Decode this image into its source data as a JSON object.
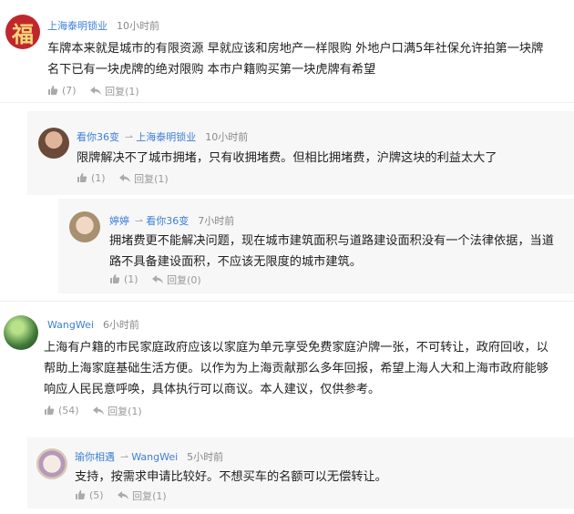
{
  "comments": [
    {
      "user": "上海泰明锁业",
      "time": "10小时前",
      "text_lines": [
        "车牌本来就是城市的有限资源 早就应该和房地产一样限购 外地户口满5年社保允许拍第一块牌",
        "名下已有一块虎牌的绝对限购 本市户籍购买第一块虎牌有希望"
      ],
      "like": "(7)",
      "reply_label": "回复",
      "reply_count": "(1)",
      "avatar_char": "福",
      "avatar_color": "#c0272d"
    },
    {
      "user": "看你36变",
      "reply_to": "上海泰明锁业",
      "time": "10小时前",
      "text_lines": [
        "限牌解决不了城市拥堵，只有收拥堵费。但相比拥堵费，沪牌这块的利益太大了"
      ],
      "like": "(1)",
      "reply_label": "回复",
      "reply_count": "(1)",
      "avatar_color": "#6b4a3a"
    },
    {
      "user": "婷婷",
      "reply_to": "看你36变",
      "time": "7小时前",
      "text_lines": [
        "拥堵费更不能解决问题，现在城市建筑面积与道路建设面积没有一个法律依据，当道",
        "路不具备建设面积，不应该无限度的城市建筑。"
      ],
      "like": "(1)",
      "reply_label": "回复",
      "reply_count": "(0)",
      "avatar_color": "#a89070"
    },
    {
      "user": "WangWei",
      "time": "6小时前",
      "text_lines": [
        "上海有户籍的市民家庭政府应该以家庭为单元享受免费家庭沪牌一张，不可转让，政府回收，以",
        "帮助上海家庭基础生活方便。以作为为上海贡献那么多年回报，希望上海人大和上海市政府能够",
        "响应人民民意呼唤，具体执行可以商议。本人建议，仅供参考。"
      ],
      "like": "(54)",
      "reply_label": "回复",
      "reply_count": "(1)",
      "avatar_color": "#3f7a3a"
    },
    {
      "user": "瑜你相遇",
      "reply_to": "WangWei",
      "time": "5小时前",
      "text_lines": [
        "支持，按需求申请比较好。不想买车的名额可以无偿转让。"
      ],
      "like": "(5)",
      "reply_label": "回复",
      "reply_count": "(1)",
      "avatar_color": "#d8c8b8"
    }
  ]
}
